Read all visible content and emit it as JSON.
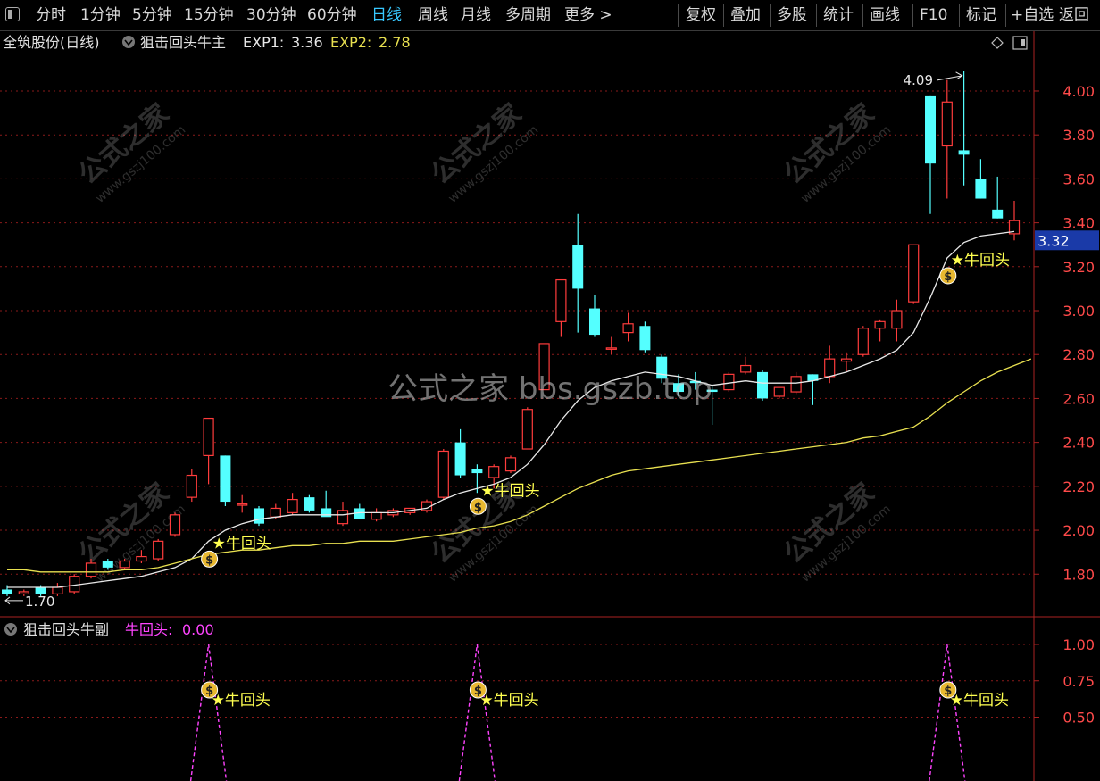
{
  "toolbar": {
    "periods": [
      "分时",
      "1分钟",
      "5分钟",
      "15分钟",
      "30分钟",
      "60分钟",
      "日线",
      "周线",
      "月线",
      "多周期",
      "更多 >"
    ],
    "active_period": "日线",
    "tools": [
      "复权",
      "叠加",
      "多股",
      "统计",
      "画线",
      "F10",
      "标记",
      "+自选",
      "返回"
    ]
  },
  "main_header": {
    "stock": "全筑股份(日线)",
    "indicator": "狙击回头牛主",
    "exp1_label": "EXP1:",
    "exp1_value": "3.36",
    "exp2_label": "EXP2:",
    "exp2_value": "2.78"
  },
  "sub_header": {
    "indicator": "狙击回头牛副",
    "signal_label": "牛回头:",
    "signal_value": "0.00"
  },
  "watermark_center": "公式之家 bbs.gszb.top",
  "watermark_small": {
    "title": "公式之家",
    "url": "www.gszj100.com"
  },
  "colors": {
    "up": "#ff3c3c",
    "down": "#54ffff",
    "ma_fast": "#e8e8e8",
    "ma_slow": "#e8e050",
    "grid": "#8a1a1a",
    "axis_text": "#ff4a4a",
    "signal": "#ff44ff",
    "marker": "#ffff50"
  },
  "chart_data": [
    {
      "type": "candlestick",
      "y_axis_ticks": [
        "4.00",
        "3.80",
        "3.60",
        "3.40",
        "3.20",
        "3.00",
        "2.80",
        "2.60",
        "2.40",
        "2.20",
        "2.00",
        "1.80"
      ],
      "ylim": [
        1.61,
        4.13
      ],
      "last_price": "3.32",
      "high_label": "4.09",
      "low_label": "1.70",
      "candles": [
        {
          "o": 1.73,
          "h": 1.75,
          "l": 1.7,
          "c": 1.71
        },
        {
          "o": 1.71,
          "h": 1.73,
          "l": 1.7,
          "c": 1.72
        },
        {
          "o": 1.74,
          "h": 1.75,
          "l": 1.7,
          "c": 1.71
        },
        {
          "o": 1.71,
          "h": 1.76,
          "l": 1.7,
          "c": 1.74
        },
        {
          "o": 1.72,
          "h": 1.8,
          "l": 1.71,
          "c": 1.79
        },
        {
          "o": 1.79,
          "h": 1.87,
          "l": 1.78,
          "c": 1.85
        },
        {
          "o": 1.86,
          "h": 1.87,
          "l": 1.82,
          "c": 1.83
        },
        {
          "o": 1.83,
          "h": 1.87,
          "l": 1.82,
          "c": 1.86
        },
        {
          "o": 1.86,
          "h": 1.91,
          "l": 1.85,
          "c": 1.88
        },
        {
          "o": 1.87,
          "h": 1.96,
          "l": 1.86,
          "c": 1.95
        },
        {
          "o": 1.98,
          "h": 2.08,
          "l": 1.97,
          "c": 2.07
        },
        {
          "o": 2.15,
          "h": 2.28,
          "l": 2.13,
          "c": 2.25
        },
        {
          "o": 2.34,
          "h": 2.51,
          "l": 2.21,
          "c": 2.51
        },
        {
          "o": 2.34,
          "h": 2.34,
          "l": 2.11,
          "c": 2.13
        },
        {
          "o": 2.12,
          "h": 2.16,
          "l": 2.08,
          "c": 2.12
        },
        {
          "o": 2.1,
          "h": 2.11,
          "l": 2.02,
          "c": 2.03
        },
        {
          "o": 2.06,
          "h": 2.12,
          "l": 2.05,
          "c": 2.1
        },
        {
          "o": 2.08,
          "h": 2.17,
          "l": 2.07,
          "c": 2.14
        },
        {
          "o": 2.15,
          "h": 2.16,
          "l": 2.08,
          "c": 2.09
        },
        {
          "o": 2.1,
          "h": 2.18,
          "l": 2.08,
          "c": 2.06
        },
        {
          "o": 2.03,
          "h": 2.13,
          "l": 2.02,
          "c": 2.09
        },
        {
          "o": 2.1,
          "h": 2.12,
          "l": 2.05,
          "c": 2.05
        },
        {
          "o": 2.05,
          "h": 2.1,
          "l": 2.04,
          "c": 2.08
        },
        {
          "o": 2.07,
          "h": 2.1,
          "l": 2.06,
          "c": 2.09
        },
        {
          "o": 2.08,
          "h": 2.1,
          "l": 2.07,
          "c": 2.1
        },
        {
          "o": 2.09,
          "h": 2.14,
          "l": 2.08,
          "c": 2.13
        },
        {
          "o": 2.15,
          "h": 2.37,
          "l": 2.14,
          "c": 2.36
        },
        {
          "o": 2.4,
          "h": 2.46,
          "l": 2.24,
          "c": 2.25
        },
        {
          "o": 2.28,
          "h": 2.3,
          "l": 2.17,
          "c": 2.26
        },
        {
          "o": 2.24,
          "h": 2.3,
          "l": 2.19,
          "c": 2.29
        },
        {
          "o": 2.27,
          "h": 2.34,
          "l": 2.26,
          "c": 2.33
        },
        {
          "o": 2.37,
          "h": 2.56,
          "l": 2.37,
          "c": 2.55
        },
        {
          "o": 2.64,
          "h": 2.85,
          "l": 2.64,
          "c": 2.85
        },
        {
          "o": 2.95,
          "h": 3.14,
          "l": 2.88,
          "c": 3.14
        },
        {
          "o": 3.3,
          "h": 3.44,
          "l": 2.9,
          "c": 3.1
        },
        {
          "o": 3.01,
          "h": 3.07,
          "l": 2.88,
          "c": 2.89
        },
        {
          "o": 2.83,
          "h": 2.88,
          "l": 2.8,
          "c": 2.83
        },
        {
          "o": 2.9,
          "h": 2.99,
          "l": 2.86,
          "c": 2.94
        },
        {
          "o": 2.93,
          "h": 2.95,
          "l": 2.81,
          "c": 2.82
        },
        {
          "o": 2.79,
          "h": 2.8,
          "l": 2.67,
          "c": 2.69
        },
        {
          "o": 2.67,
          "h": 2.71,
          "l": 2.61,
          "c": 2.63
        },
        {
          "o": 2.68,
          "h": 2.72,
          "l": 2.64,
          "c": 2.67
        },
        {
          "o": 2.64,
          "h": 2.66,
          "l": 2.48,
          "c": 2.63
        },
        {
          "o": 2.64,
          "h": 2.72,
          "l": 2.63,
          "c": 2.71
        },
        {
          "o": 2.72,
          "h": 2.79,
          "l": 2.71,
          "c": 2.75
        },
        {
          "o": 2.72,
          "h": 2.73,
          "l": 2.59,
          "c": 2.6
        },
        {
          "o": 2.61,
          "h": 2.65,
          "l": 2.6,
          "c": 2.65
        },
        {
          "o": 2.63,
          "h": 2.72,
          "l": 2.62,
          "c": 2.7
        },
        {
          "o": 2.71,
          "h": 2.71,
          "l": 2.57,
          "c": 2.68
        },
        {
          "o": 2.7,
          "h": 2.84,
          "l": 2.67,
          "c": 2.78
        },
        {
          "o": 2.77,
          "h": 2.81,
          "l": 2.72,
          "c": 2.78
        },
        {
          "o": 2.8,
          "h": 2.93,
          "l": 2.79,
          "c": 2.92
        },
        {
          "o": 2.92,
          "h": 2.96,
          "l": 2.86,
          "c": 2.95
        },
        {
          "o": 2.92,
          "h": 3.05,
          "l": 2.86,
          "c": 3.0
        },
        {
          "o": 3.04,
          "h": 3.3,
          "l": 3.03,
          "c": 3.3
        },
        {
          "o": 3.98,
          "h": 3.98,
          "l": 3.44,
          "c": 3.67
        },
        {
          "o": 3.75,
          "h": 4.05,
          "l": 3.51,
          "c": 3.95
        },
        {
          "o": 3.73,
          "h": 4.09,
          "l": 3.57,
          "c": 3.71
        },
        {
          "o": 3.6,
          "h": 3.69,
          "l": 3.51,
          "c": 3.51
        },
        {
          "o": 3.46,
          "h": 3.61,
          "l": 3.42,
          "c": 3.42
        },
        {
          "o": 3.35,
          "h": 3.5,
          "l": 3.32,
          "c": 3.41
        }
      ],
      "series": [
        {
          "name": "EXP1",
          "values": [
            1.74,
            1.74,
            1.74,
            1.74,
            1.75,
            1.76,
            1.77,
            1.78,
            1.79,
            1.81,
            1.83,
            1.87,
            1.95,
            2.0,
            2.03,
            2.05,
            2.06,
            2.07,
            2.07,
            2.07,
            2.07,
            2.08,
            2.08,
            2.08,
            2.09,
            2.1,
            2.14,
            2.17,
            2.19,
            2.21,
            2.24,
            2.3,
            2.39,
            2.5,
            2.59,
            2.65,
            2.68,
            2.7,
            2.72,
            2.71,
            2.7,
            2.68,
            2.66,
            2.67,
            2.68,
            2.67,
            2.67,
            2.67,
            2.68,
            2.7,
            2.72,
            2.75,
            2.78,
            2.82,
            2.9,
            3.06,
            3.24,
            3.31,
            3.34,
            3.35,
            3.36
          ]
        },
        {
          "name": "EXP2",
          "values": [
            1.82,
            1.82,
            1.81,
            1.81,
            1.81,
            1.81,
            1.81,
            1.82,
            1.82,
            1.83,
            1.85,
            1.87,
            1.89,
            1.9,
            1.91,
            1.91,
            1.92,
            1.93,
            1.93,
            1.94,
            1.94,
            1.95,
            1.95,
            1.95,
            1.96,
            1.97,
            1.98,
            1.99,
            2.01,
            2.02,
            2.04,
            2.07,
            2.11,
            2.15,
            2.19,
            2.22,
            2.25,
            2.27,
            2.28,
            2.29,
            2.3,
            2.31,
            2.32,
            2.33,
            2.34,
            2.35,
            2.36,
            2.37,
            2.38,
            2.39,
            2.4,
            2.42,
            2.43,
            2.45,
            2.47,
            2.52,
            2.58,
            2.63,
            2.68,
            2.72,
            2.75,
            2.78
          ]
        }
      ],
      "signals": [
        {
          "index": 12,
          "label": "★牛回头"
        },
        {
          "index": 28,
          "label": "★牛回头"
        },
        {
          "index": 56,
          "label": "★牛回头"
        }
      ]
    },
    {
      "type": "line",
      "name": "牛回头",
      "y_axis_ticks": [
        "1.00",
        "0.75",
        "0.50"
      ],
      "ylim": [
        0,
        1.0
      ],
      "peaks": [
        12,
        28,
        56
      ],
      "labels": [
        "★牛回头",
        "★牛回头",
        "★牛回头"
      ]
    }
  ]
}
